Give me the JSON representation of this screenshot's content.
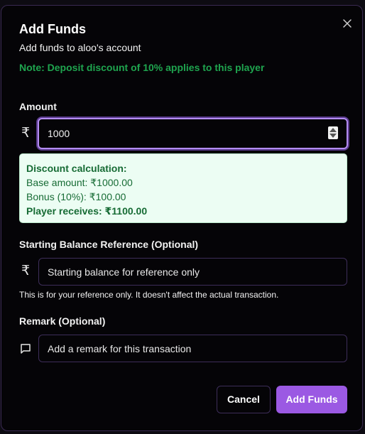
{
  "dialog": {
    "title": "Add Funds",
    "subtitle": "Add funds to aloo's account",
    "note": "Note: Deposit discount of 10% applies to this player",
    "close_icon": "close-icon"
  },
  "amount": {
    "label": "Amount",
    "currency_symbol": "₹",
    "value": "1000"
  },
  "discount": {
    "heading": "Discount calculation:",
    "base_amount": "Base amount: ₹1000.00",
    "bonus": "Bonus (10%): ₹100.00",
    "player_receives": "Player receives: ₹1100.00"
  },
  "starting_balance": {
    "label": "Starting Balance Reference (Optional)",
    "currency_symbol": "₹",
    "placeholder": "Starting balance for reference only",
    "hint": "This is for your reference only. It doesn't affect the actual transaction."
  },
  "remark": {
    "label": "Remark (Optional)",
    "icon": "message-square-icon",
    "placeholder": "Add a remark for this transaction"
  },
  "buttons": {
    "cancel": "Cancel",
    "submit": "Add Funds"
  },
  "colors": {
    "accent": "#9b59e3",
    "note_green": "#1fa54f",
    "discount_bg": "#ecfdf3",
    "background": "#050407"
  }
}
